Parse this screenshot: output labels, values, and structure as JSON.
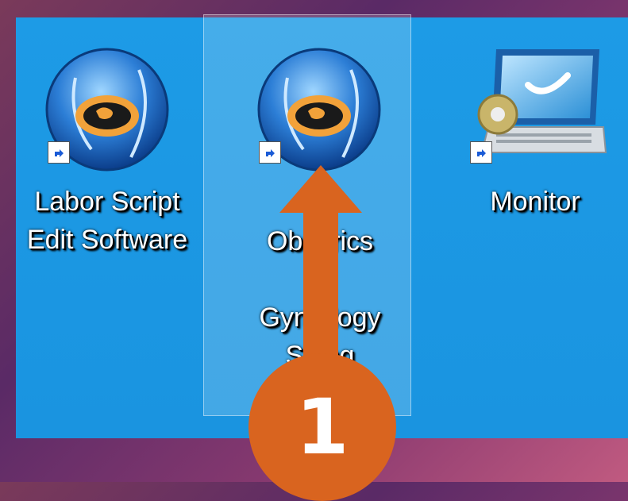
{
  "desktop": {
    "icons": [
      {
        "name": "labor-script-edit-software",
        "label": "Labor Script\nEdit Software",
        "icon": "obstetrics-app-icon",
        "shortcut": true,
        "selected": false
      },
      {
        "name": "obstetrics-gynecology-app",
        "label": "Obs   trics\n    d\nGyne  logy\nSk        ng",
        "icon": "obstetrics-app-icon",
        "shortcut": true,
        "selected": true
      },
      {
        "name": "monitor",
        "label": "Monitor",
        "icon": "monitor-icon",
        "shortcut": true,
        "selected": false
      }
    ]
  },
  "annotation": {
    "step_number": "1",
    "arrow_color": "#d9641f",
    "arrow_direction": "up"
  }
}
